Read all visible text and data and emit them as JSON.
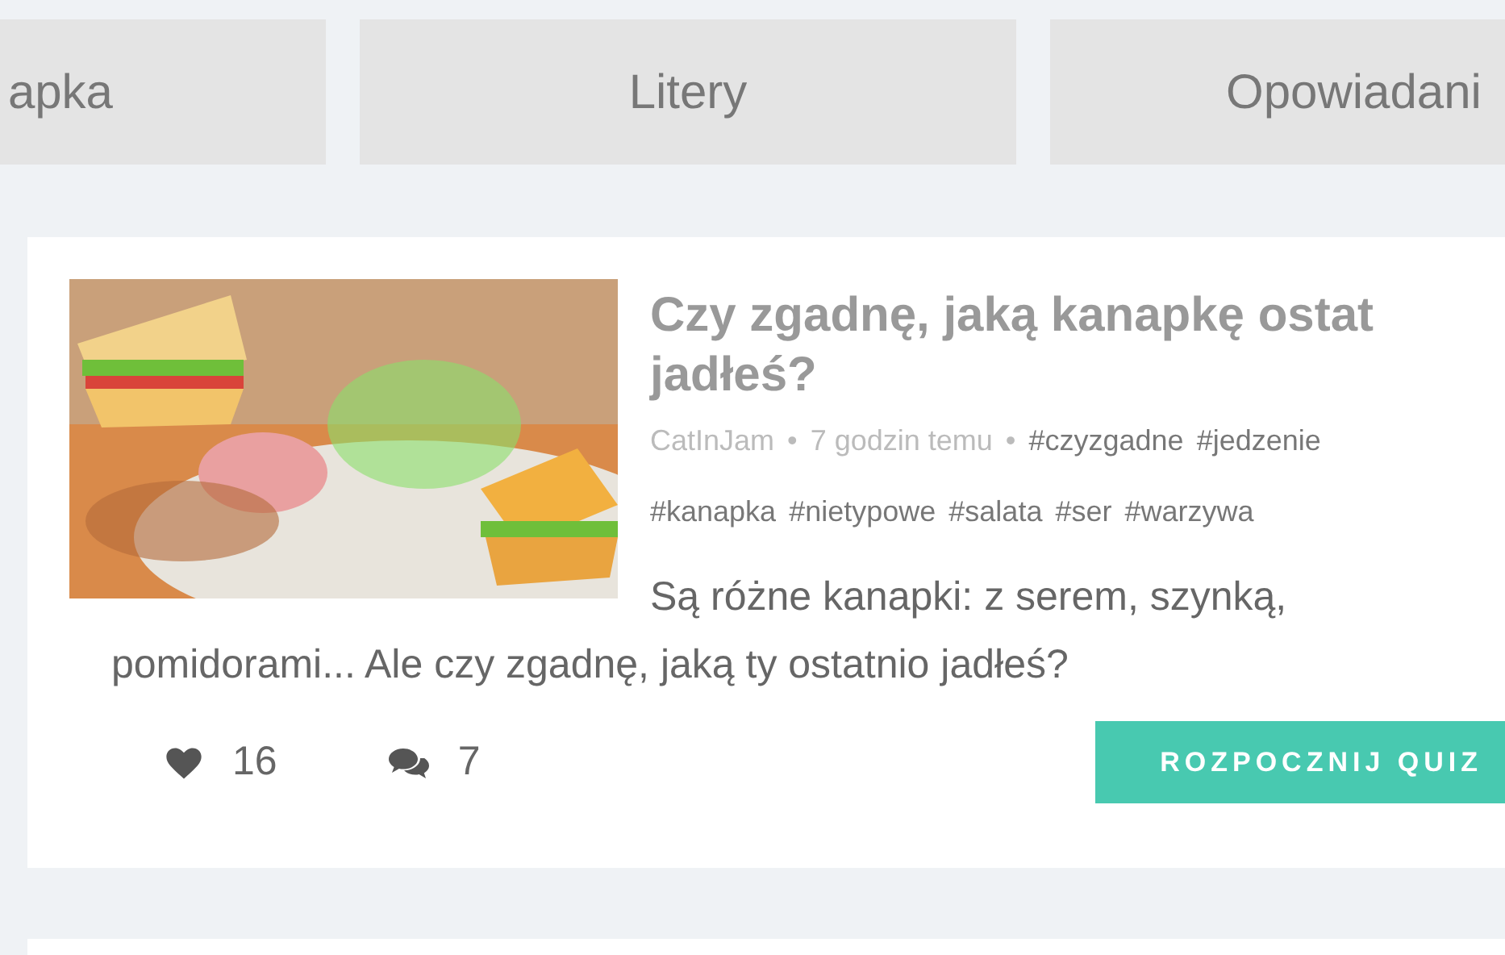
{
  "categories": [
    {
      "label": "apka",
      "selected": false
    },
    {
      "label": "Litery",
      "selected": false
    },
    {
      "label": "Opowiadani",
      "selected": false
    }
  ],
  "quiz": {
    "title": "Czy zgadnę, jaką kanapkę ostat jadłeś?",
    "author": "CatInJam",
    "separator": "•",
    "time": "7 godzin temu",
    "tags": [
      "#czyzgadne",
      "#jedzenie",
      "#kanapka",
      "#nietypowe",
      "#salata",
      "#ser",
      "#warzywa"
    ],
    "description": "Są różne kanapki: z serem, szynką, pomidorami... Ale czy zgadnę, jaką ty ostatnio jadłeś?",
    "likes": "16",
    "comments": "7",
    "button": "ROZPOCZNIJ QUIZ"
  }
}
